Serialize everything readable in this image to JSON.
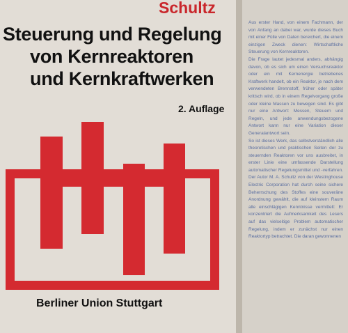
{
  "cover": {
    "author": "Schultz",
    "title_line1": "Steuerung und Regelung",
    "title_line2": "von Kernreaktoren",
    "title_line3": "und Kernkraftwerken",
    "edition": "2. Auflage",
    "publisher": "Berliner Union Stuttgart",
    "accent_color": "#d42a30"
  },
  "flap": {
    "paragraphs": [
      "Aus erster Hand, von einem Fachmann, der von Anfang an dabei war, wurde dieses Buch mit einer Fülle von Daten bereichert, die einem einzigen Zweck dienen: Wirtschaftliche Steuerung von Kernreaktoren.",
      "Die Frage lautet jedesmal anders, abhängig davon, ob es sich um einen Versuchsreaktor oder ein mit Kernenergie betriebenes Kraftwerk handelt, ob ein Reaktor, je nach dem verwendeten Brennstoff, früher oder später kritisch wird, ob in einem Regelvorgang große oder kleine Massen zu bewegen sind. Es gibt nur eine Antwort: Messen, Steuern und Regeln, und jede anwendungsbezogene Antwort kann nur eine Variation dieser Generalantwort sein.",
      "So ist dieses Werk, das selbstverständlich alle theoretischen und praktischen Seiten der zu steuernden Reaktoren vor uns ausbreitet, in erster Linie eine umfassende Darstellung automatischer Regelungsmittel und -verfahren. Der Autor M. A. Schultz von der Westinghouse Electric Corporation hat durch seine sichere Beherrschung des Stoffes eine souveräne Anordnung gewählt, die auf kleinstem Raum alle einschlägigen Kenntnisse vermittelt: Er konzentriert die Aufmerksamkeit des Lesers auf das vielseitige Problem automatischer Regelung, indem er zunächst nur einen Reaktortyp betrachtet. Die daran gewonnenen"
    ]
  }
}
